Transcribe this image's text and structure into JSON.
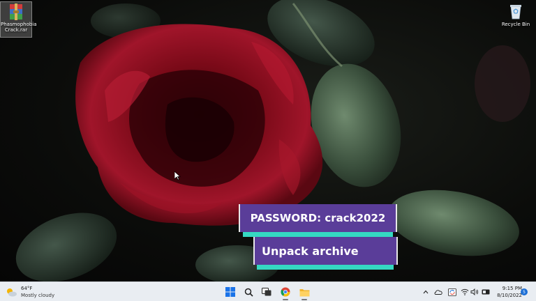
{
  "desktop": {
    "icons": [
      {
        "label": "Phasmophobia Crack.rar",
        "icon": "winrar-archive-icon"
      },
      {
        "label": "Recycle Bin",
        "icon": "recycle-bin-icon"
      }
    ]
  },
  "overlay": {
    "password_text": "PASSWORD: crack2022",
    "unpack_text": "Unpack archive",
    "banner_color": "#5a3d99",
    "stripe_color": "#35d8c2"
  },
  "taskbar": {
    "weather": {
      "temp": "64°F",
      "condition": "Mostly cloudy",
      "icon": "partly-cloudy-icon"
    },
    "pinned": [
      {
        "name": "start",
        "icon": "windows-start-icon"
      },
      {
        "name": "search",
        "icon": "search-icon"
      },
      {
        "name": "task-view",
        "icon": "task-view-icon"
      },
      {
        "name": "chrome",
        "icon": "chrome-icon"
      },
      {
        "name": "file-explorer",
        "icon": "folder-icon"
      }
    ],
    "tray": {
      "icons": [
        "chevron-up-icon",
        "onedrive-icon",
        "sync-icon",
        "wifi-icon",
        "speaker-icon",
        "meet-now-icon"
      ],
      "time": "9:15 PM",
      "date": "8/10/2022",
      "notification_count": "5"
    },
    "background": "#e9edf2",
    "accent": "#1b6ed6"
  }
}
